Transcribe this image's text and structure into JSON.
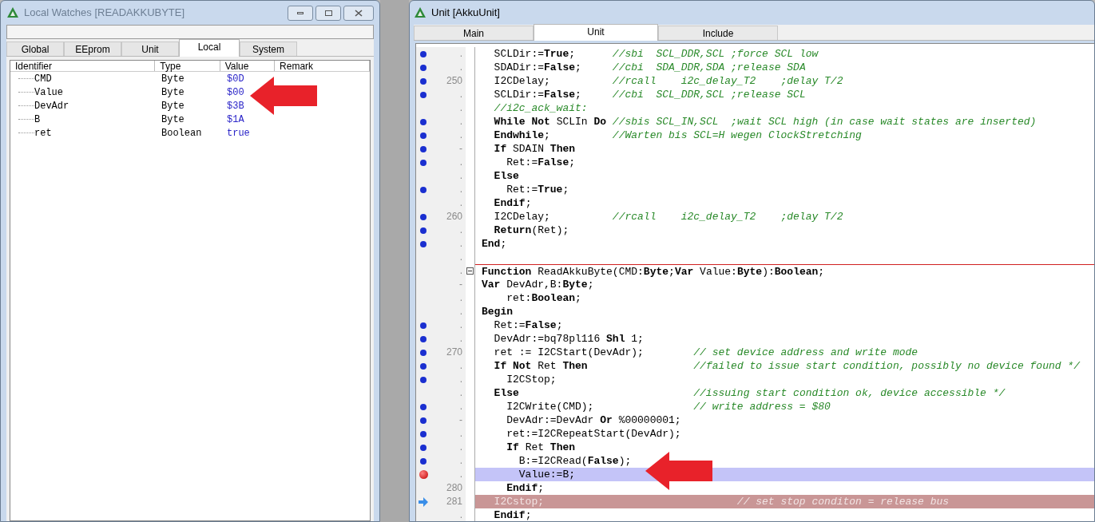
{
  "watch_window": {
    "title": "Local Watches [READAKKUBYTE]",
    "tabs": [
      {
        "label": "Global",
        "selected": false
      },
      {
        "label": "EEprom",
        "selected": false
      },
      {
        "label": "Unit",
        "selected": false
      },
      {
        "label": "Local",
        "selected": true
      },
      {
        "label": "System",
        "selected": false
      }
    ],
    "columns": [
      "Identifier",
      "Type",
      "Value",
      "Remark"
    ],
    "rows": [
      {
        "identifier": "CMD",
        "type": "Byte",
        "value": "$0D"
      },
      {
        "identifier": "Value",
        "type": "Byte",
        "value": "$00"
      },
      {
        "identifier": "DevAdr",
        "type": "Byte",
        "value": "$3B"
      },
      {
        "identifier": "B",
        "type": "Byte",
        "value": "$1A"
      },
      {
        "identifier": "ret",
        "type": "Boolean",
        "value": "true"
      }
    ]
  },
  "unit_window": {
    "title": "Unit [AkkuUnit]",
    "tabs": [
      {
        "label": "Main",
        "selected": false
      },
      {
        "label": "Unit",
        "selected": true
      },
      {
        "label": "Include",
        "selected": false
      }
    ],
    "lines": [
      {
        "kind": "executable",
        "number": ".",
        "code": "  SCLDir:=**True**;      ",
        "comment": "//sbi  SCL_DDR,SCL ;force SCL low"
      },
      {
        "kind": "executable",
        "number": ".",
        "code": "  SDADir:=**False**;     ",
        "comment": "//cbi  SDA_DDR,SDA ;release SDA"
      },
      {
        "kind": "executable",
        "number": "250",
        "code": "  I2CDelay;          ",
        "comment": "//rcall    i2c_delay_T2    ;delay T/2"
      },
      {
        "kind": "executable",
        "number": ".",
        "code": "  SCLDir:=**False**;     ",
        "comment": "//cbi  SCL_DDR,SCL ;release SCL"
      },
      {
        "kind": "plain",
        "number": ".",
        "comment": "  //i2c_ack_wait:"
      },
      {
        "kind": "executable",
        "number": ".",
        "code": "  **While Not** SCLIn **Do** ",
        "comment": "//sbis SCL_IN,SCL  ;wait SCL high (in case wait states are inserted)"
      },
      {
        "kind": "executable",
        "number": ".",
        "code": "  **Endwhile**;          ",
        "comment": "//Warten bis SCL=H wegen ClockStretching"
      },
      {
        "kind": "executable",
        "number": "-",
        "code": "  **If** SDAIN **Then**"
      },
      {
        "kind": "executable",
        "number": ".",
        "code": "    Ret:=**False**;"
      },
      {
        "kind": "plain",
        "number": ".",
        "code": "  **Else**"
      },
      {
        "kind": "executable",
        "number": ".",
        "code": "    Ret:=**True**;"
      },
      {
        "kind": "plain",
        "number": ".",
        "code": "  **Endif**;"
      },
      {
        "kind": "executable",
        "number": "260",
        "code": "  I2CDelay;          ",
        "comment": "//rcall    i2c_delay_T2    ;delay T/2"
      },
      {
        "kind": "executable",
        "number": ".",
        "code": "  **Return**(Ret);"
      },
      {
        "kind": "executable",
        "number": ".",
        "code": "**End**;"
      },
      {
        "kind": "plain",
        "number": "."
      },
      {
        "kind": "plain",
        "number": ".",
        "fold": true,
        "code": "**Function** ReadAkkuByte(CMD:**Byte**;**Var** Value:**Byte**):**Boolean**;"
      },
      {
        "kind": "plain",
        "number": "-",
        "code": "**Var** DevAdr,B:**Byte**;"
      },
      {
        "kind": "plain",
        "number": ".",
        "code": "    ret:**Boolean**;"
      },
      {
        "kind": "plain",
        "number": ".",
        "code": "**Begin**"
      },
      {
        "kind": "executable",
        "number": ".",
        "code": "  Ret:=**False**;"
      },
      {
        "kind": "executable",
        "number": ".",
        "code": "  DevAdr:=bq78pl116 **Shl** 1;"
      },
      {
        "kind": "executable",
        "number": "270",
        "code": "  ret := I2CStart(DevAdr);        ",
        "comment": "// set device address and write mode"
      },
      {
        "kind": "executable",
        "number": ".",
        "code": "  **If Not** Ret **Then**                 ",
        "comment": "//failed to issue start condition, possibly no device found */"
      },
      {
        "kind": "executable",
        "number": ".",
        "code": "    I2CStop;"
      },
      {
        "kind": "plain",
        "number": ".",
        "code": "  **Else**                            ",
        "comment": "//issuing start condition ok, device accessible */"
      },
      {
        "kind": "executable",
        "number": ".",
        "code": "    I2CWrite(CMD);                ",
        "comment": "// write address = $80"
      },
      {
        "kind": "executable",
        "number": "-",
        "code": "    DevAdr:=DevAdr **Or** %00000001;"
      },
      {
        "kind": "executable",
        "number": ".",
        "code": "    ret:=I2CRepeatStart(DevAdr);"
      },
      {
        "kind": "executable",
        "number": ".",
        "code": "    **If** Ret **Then**"
      },
      {
        "kind": "executable",
        "number": ".",
        "code": "      B:=I2CRead(**False**);"
      },
      {
        "kind": "breakpoint",
        "number": ".",
        "code": "      Value:=B;"
      },
      {
        "kind": "plain",
        "number": "280",
        "code": "    **Endif**;"
      },
      {
        "kind": "current",
        "number": "281",
        "code": "  I2Cstop;                               ",
        "comment": "// set stop conditon = release bus"
      },
      {
        "kind": "plain",
        "number": ".",
        "code": "  **Endif**;"
      }
    ]
  }
}
